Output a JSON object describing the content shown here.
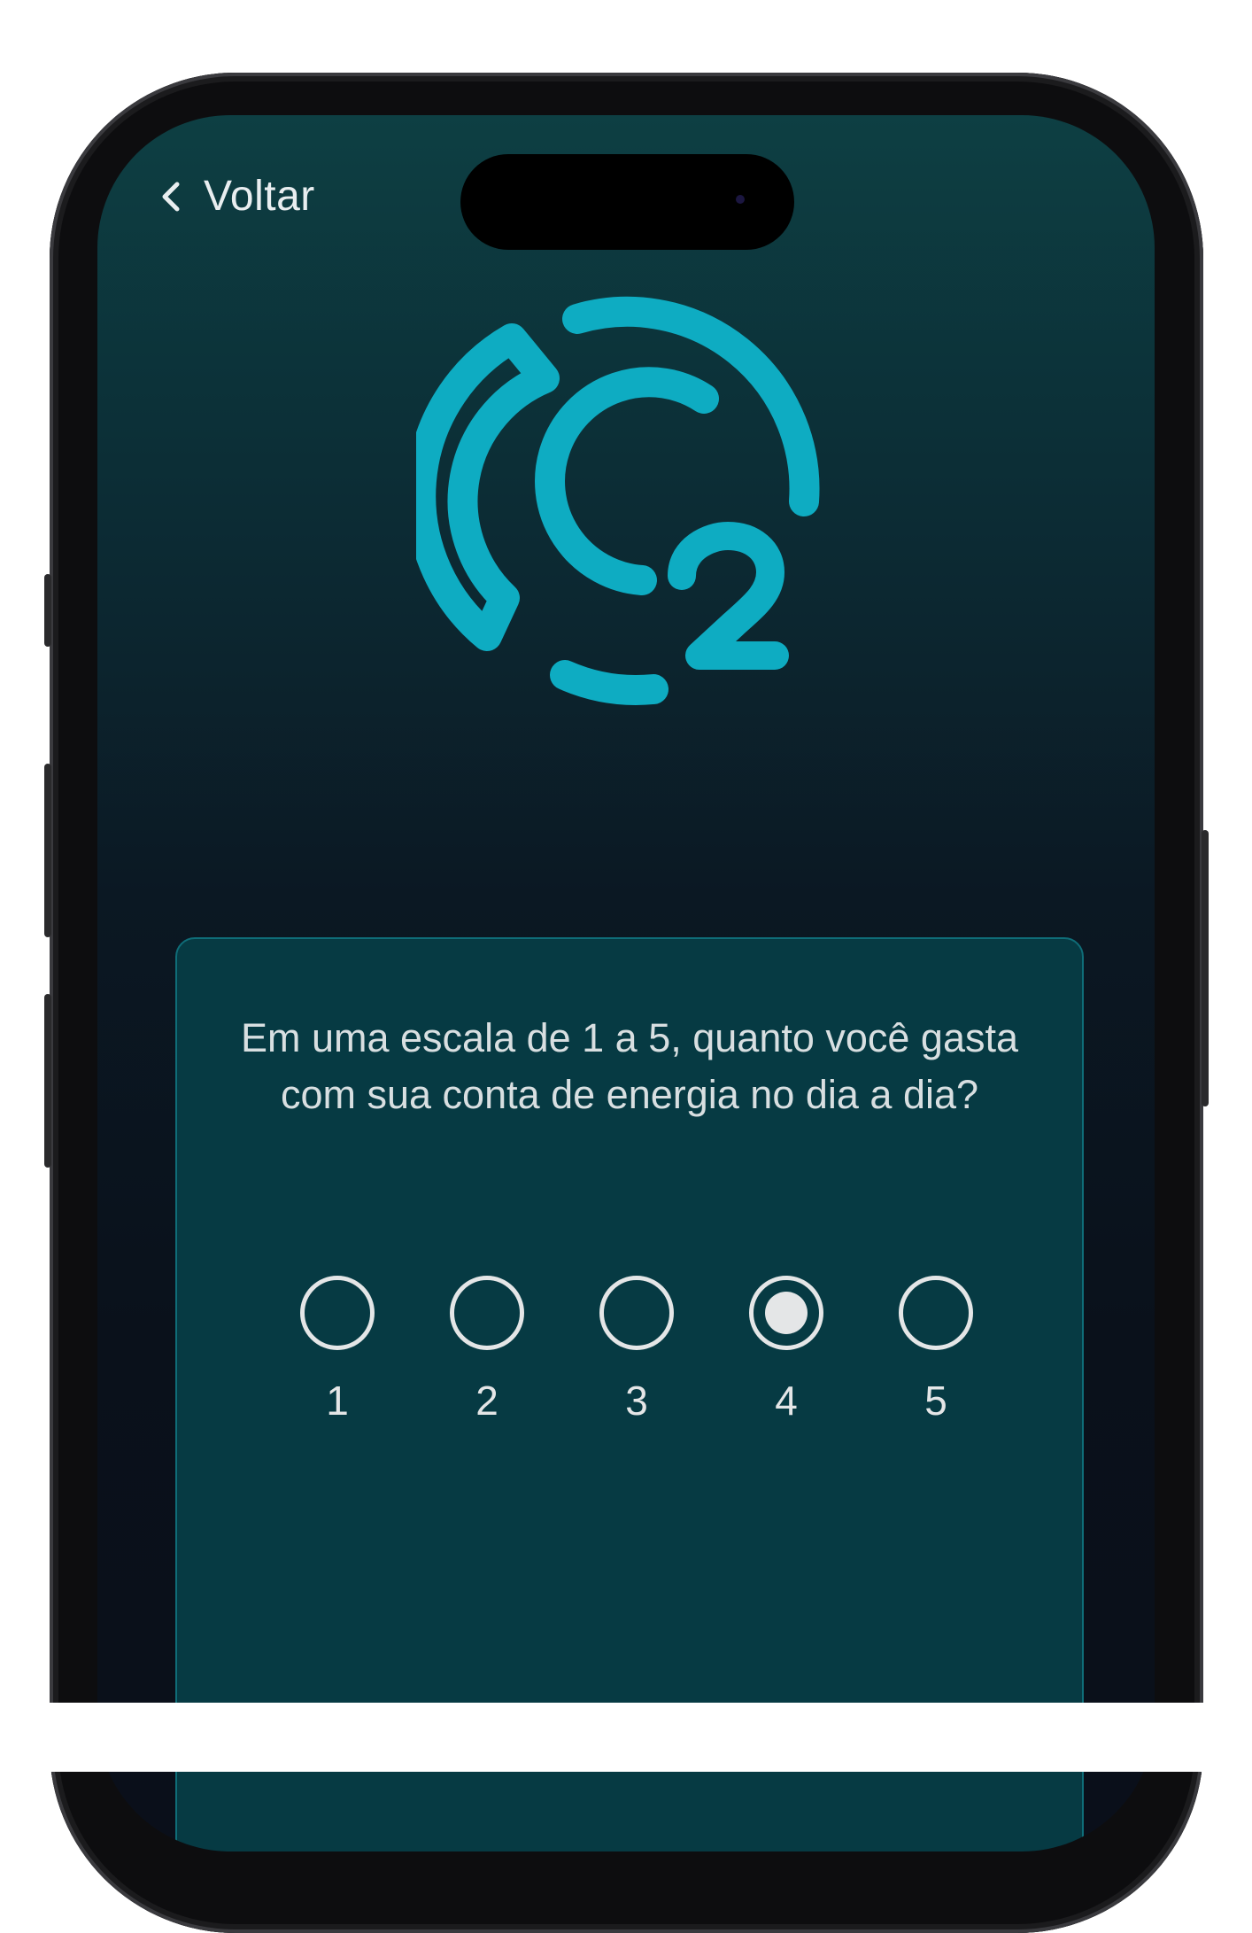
{
  "nav": {
    "back_label": "Voltar"
  },
  "logo": {
    "icon": "c2-logo-icon",
    "color": "#0eacc2"
  },
  "survey": {
    "question": "Em uma escala de 1 a 5, quanto você gasta com sua conta de energia no dia a dia?",
    "options": [
      {
        "label": "1",
        "selected": false
      },
      {
        "label": "2",
        "selected": false
      },
      {
        "label": "3",
        "selected": false
      },
      {
        "label": "4",
        "selected": true
      },
      {
        "label": "5",
        "selected": false
      }
    ],
    "selected_value": "4"
  },
  "colors": {
    "accent": "#0eacc2",
    "card_background": "#063a43",
    "card_border": "#0f6d78",
    "text": "#d8dfe1"
  }
}
